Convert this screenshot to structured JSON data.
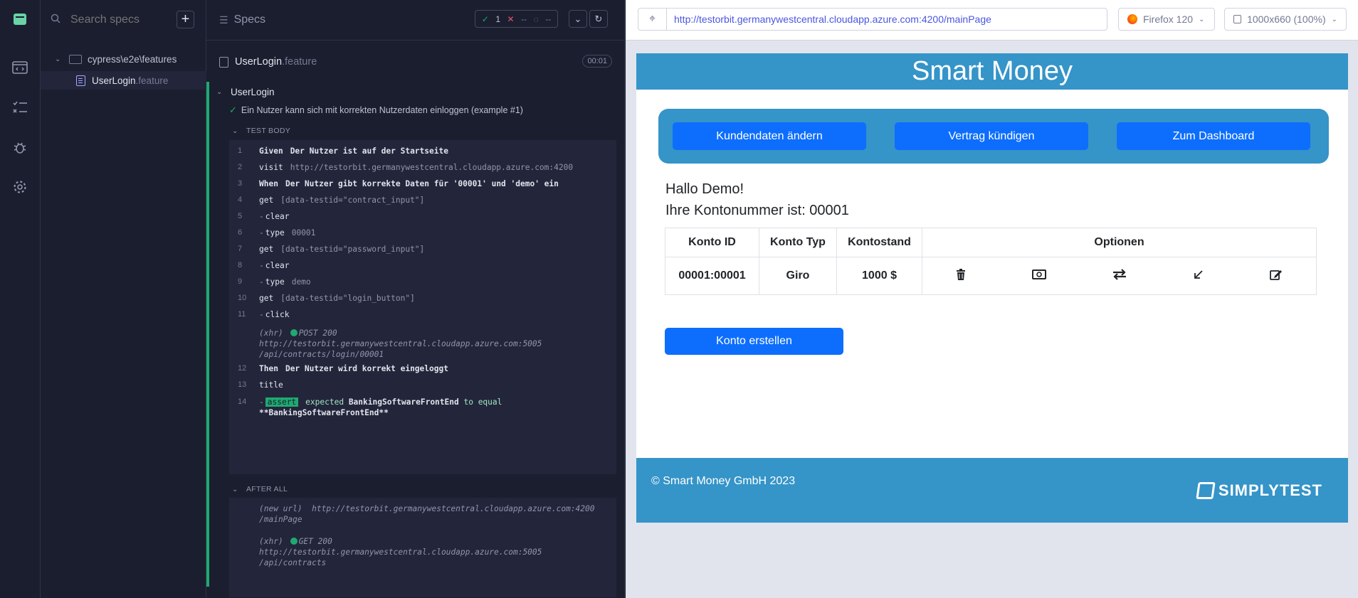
{
  "specs_panel": {
    "search_placeholder": "Search specs",
    "add_label": "+",
    "folder": "cypress\\e2e\\features",
    "file_name": "UserLogin",
    "file_ext": ".feature"
  },
  "reporter": {
    "title": "Specs",
    "passed": "1",
    "failed": "--",
    "pending": "--",
    "spec_name": "UserLogin",
    "spec_ext": ".feature",
    "duration": "00:01",
    "suite": "UserLogin",
    "test": "Ein Nutzer kann sich mit korrekten Nutzerdaten einloggen (example #1)",
    "section_body": "TEST BODY",
    "section_after": "AFTER ALL",
    "commands": [
      {
        "n": "1",
        "kw": "Given",
        "text": "Der Nutzer ist auf der Startseite"
      },
      {
        "n": "2",
        "cmd": "visit",
        "arg": "http://testorbit.germanywestcentral.cloudapp.azure.com:4200"
      },
      {
        "n": "3",
        "kw": "When",
        "text": "Der Nutzer gibt korrekte Daten für '00001' und 'demo' ein"
      },
      {
        "n": "4",
        "cmd": "get",
        "arg": "[data-testid=\"contract_input\"]"
      },
      {
        "n": "5",
        "cmd": "clear",
        "arg": ""
      },
      {
        "n": "6",
        "cmd": "type",
        "arg": "00001"
      },
      {
        "n": "7",
        "cmd": "get",
        "arg": "[data-testid=\"password_input\"]"
      },
      {
        "n": "8",
        "cmd": "clear",
        "arg": ""
      },
      {
        "n": "9",
        "cmd": "type",
        "arg": "demo"
      },
      {
        "n": "10",
        "cmd": "get",
        "arg": "[data-testid=\"login_button\"]"
      },
      {
        "n": "11",
        "cmd": "click",
        "arg": ""
      },
      {
        "n": "12",
        "kw": "Then",
        "text": "Der Nutzer wird korrekt eingeloggt"
      },
      {
        "n": "13",
        "cmd": "title",
        "arg": ""
      },
      {
        "n": "14",
        "assert": "assert",
        "a1": "expected",
        "a2": "BankingSoftwareFrontEnd",
        "a3": "to equal",
        "a4": "**BankingSoftwareFrontEnd**"
      }
    ],
    "xhr1": {
      "tag": "(xhr)",
      "method": "POST 200",
      "url1": "http://testorbit.germanywestcentral.cloudapp.azure.com:5005",
      "url2": "/api/contracts/login/00001"
    },
    "newurl": {
      "tag": "(new url)",
      "url1": "http://testorbit.germanywestcentral.cloudapp.azure.com:4200",
      "url2": "/mainPage"
    },
    "xhr2": {
      "tag": "(xhr)",
      "method": "GET 200",
      "url1": "http://testorbit.germanywestcentral.cloudapp.azure.com:5005",
      "url2": "/api/contracts"
    }
  },
  "browser": {
    "url": "http://testorbit.germanywestcentral.cloudapp.azure.com:4200/mainPage",
    "browser_name": "Firefox 120",
    "viewport": "1000x660",
    "zoom": "(100%)"
  },
  "app": {
    "title": "Smart Money",
    "nav": [
      "Kundendaten ändern",
      "Vertrag kündigen",
      "Zum Dashboard"
    ],
    "greeting": "Hallo Demo!",
    "account_line": "Ihre Kontonummer ist: 00001",
    "table": {
      "headers": [
        "Konto ID",
        "Konto Typ",
        "Kontostand",
        "Optionen"
      ],
      "row": [
        "00001:00001",
        "Giro",
        "1000 $"
      ],
      "option_icons": [
        "trash-icon",
        "money-icon",
        "transfer-icon",
        "arrow-down-left-icon",
        "edit-icon"
      ]
    },
    "create_button": "Konto erstellen",
    "footer": "© Smart Money GmbH 2023",
    "footer_brand": "SIMPLYTEST"
  },
  "colors": {
    "passed": "#1fa971",
    "failed": "#e45770",
    "app_blue": "#3594c8",
    "button_blue": "#0d6efd"
  }
}
